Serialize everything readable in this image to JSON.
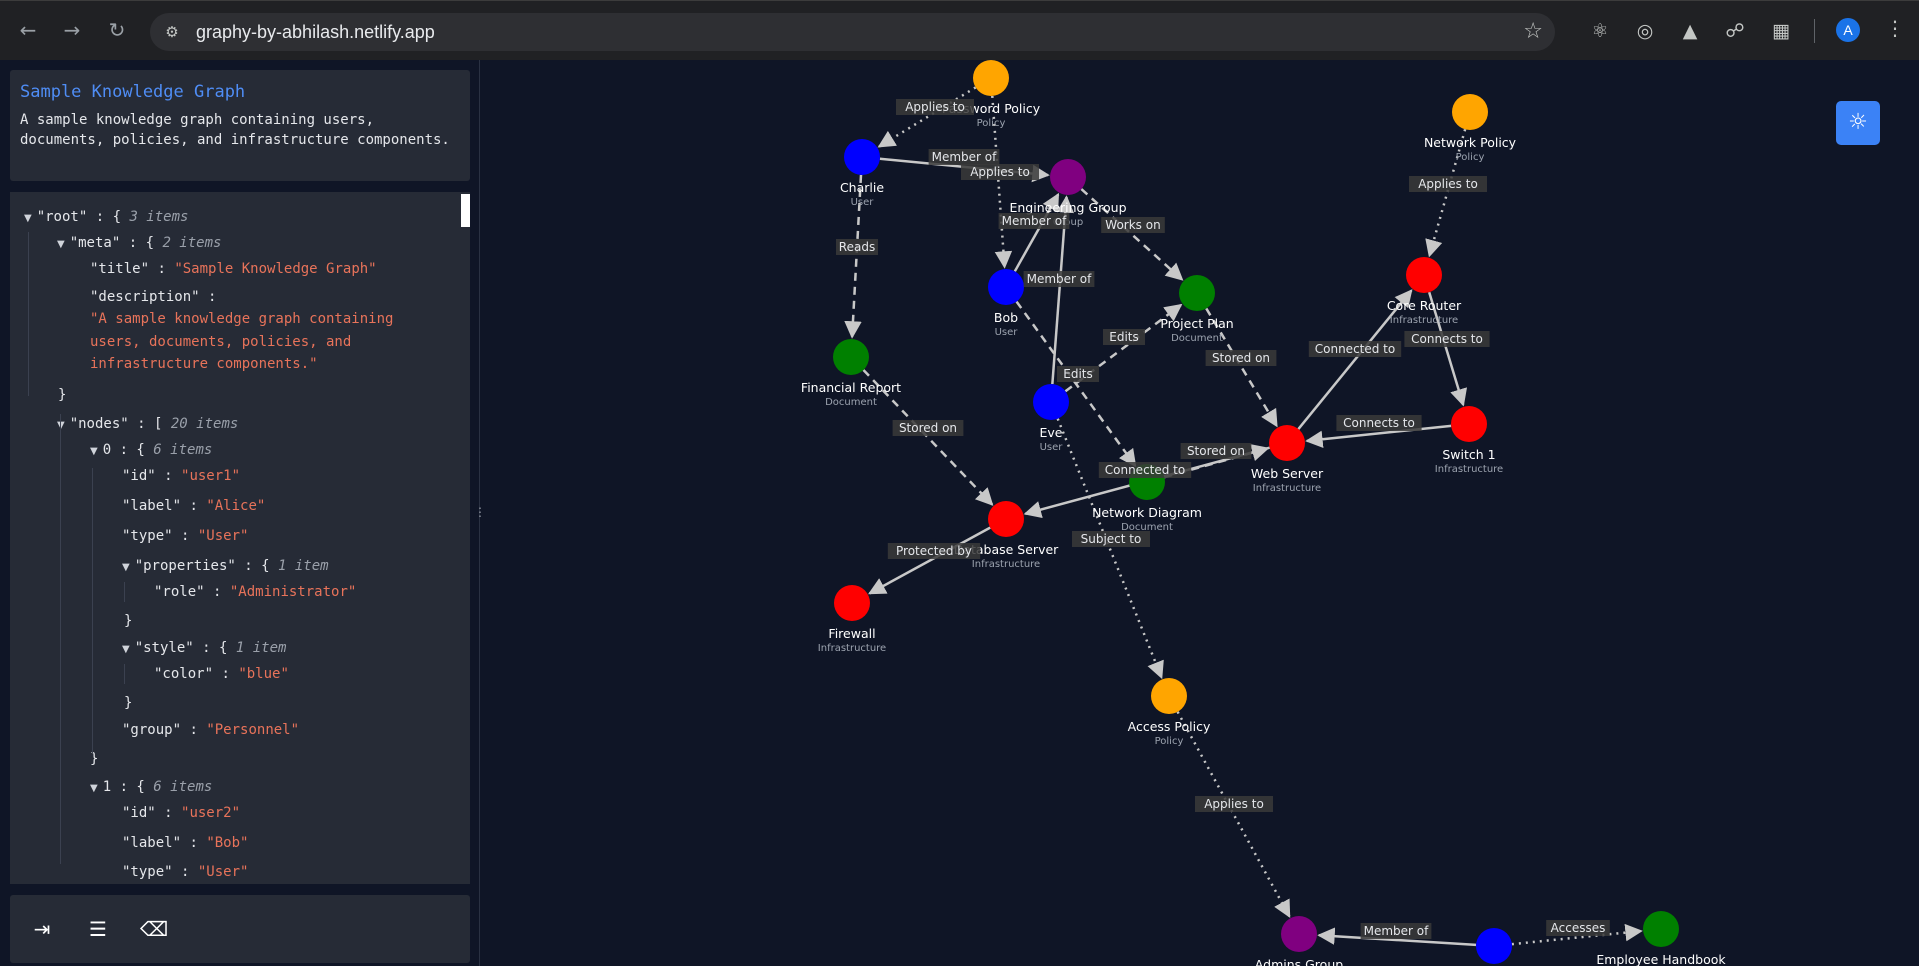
{
  "browser": {
    "url": "graphy-by-abhilash.netlify.app",
    "avatar_letter": "A",
    "icons": [
      "back-arrow-icon",
      "forward-arrow-icon",
      "reload-icon",
      "site-settings-icon",
      "star-icon",
      "react-devtools-icon",
      "target-extension-icon",
      "angular-extension-icon",
      "graph-extension-icon",
      "extensions-puzzle-icon",
      "more-menu-icon"
    ]
  },
  "info": {
    "title": "Sample Knowledge Graph",
    "description": "A sample knowledge graph containing users, documents, policies, and infrastructure components."
  },
  "json_tree": [
    {
      "text": "\"root\"",
      "suffix": " : { ",
      "count": "3 items",
      "toggle": true
    },
    {
      "text": "\"meta\"",
      "suffix": " : { ",
      "count": "2 items",
      "toggle": true
    },
    {
      "key": "\"title\"",
      "value": "\"Sample Knowledge Graph\""
    },
    {
      "key": "\"description\"",
      "sep": " :"
    },
    {
      "value": "\"A sample knowledge graph containing"
    },
    {
      "value": "users, documents, policies, and"
    },
    {
      "value": "infrastructure components.\""
    },
    {
      "brace": "}"
    },
    {
      "text": "\"nodes\"",
      "suffix": " : [ ",
      "count": "20 items",
      "toggle": true
    },
    {
      "text": "0",
      "suffix": " : { ",
      "count": "6 items",
      "toggle": true
    },
    {
      "key": "\"id\"",
      "value": "\"user1\""
    },
    {
      "key": "\"label\"",
      "value": "\"Alice\""
    },
    {
      "key": "\"type\"",
      "value": "\"User\""
    },
    {
      "text": "\"properties\"",
      "suffix": " : { ",
      "count": "1 item",
      "toggle": true
    },
    {
      "key": "\"role\"",
      "value": "\"Administrator\""
    },
    {
      "brace": "}"
    },
    {
      "text": "\"style\"",
      "suffix": " : { ",
      "count": "1 item",
      "toggle": true
    },
    {
      "key": "\"color\"",
      "value": "\"blue\""
    },
    {
      "brace": "}"
    },
    {
      "key": "\"group\"",
      "value": "\"Personnel\""
    },
    {
      "brace": "}"
    },
    {
      "text": "1",
      "suffix": " : { ",
      "count": "6 items",
      "toggle": true
    },
    {
      "key": "\"id\"",
      "value": "\"user2\""
    },
    {
      "key": "\"label\"",
      "value": "\"Bob\""
    },
    {
      "key": "\"type\"",
      "value": "\"User\""
    }
  ],
  "bottom_buttons": [
    {
      "name": "import-button",
      "icon": "file-import-icon",
      "color": "#3b82f6"
    },
    {
      "name": "database-button",
      "icon": "database-icon",
      "color": "#000000"
    },
    {
      "name": "clear-button",
      "icon": "eraser-icon",
      "color": "#b91c1c"
    }
  ],
  "graph": {
    "colors": {
      "User": "#0000ff",
      "Document": "#008000",
      "Policy": "#ffa500",
      "Group": "#800080",
      "Infrastructure": "#ff0000"
    },
    "nodes": [
      {
        "id": "pw",
        "label": "Password Policy",
        "type": "Policy"
      },
      {
        "id": "charlie",
        "label": "Charlie",
        "type": "User"
      },
      {
        "id": "eng",
        "label": "Engineering Group",
        "type": "Group"
      },
      {
        "id": "netpol",
        "label": "Network Policy",
        "type": "Policy"
      },
      {
        "id": "bob",
        "label": "Bob",
        "type": "User"
      },
      {
        "id": "projplan",
        "label": "Project Plan",
        "type": "Document"
      },
      {
        "id": "corerouter",
        "label": "Core Router",
        "type": "Infrastructure"
      },
      {
        "id": "finreport",
        "label": "Financial Report",
        "type": "Document"
      },
      {
        "id": "eve",
        "label": "Eve",
        "type": "User"
      },
      {
        "id": "webserver",
        "label": "Web Server",
        "type": "Infrastructure"
      },
      {
        "id": "switch1",
        "label": "Switch 1",
        "type": "Infrastructure"
      },
      {
        "id": "netdiag",
        "label": "Network Diagram",
        "type": "Document"
      },
      {
        "id": "dbserver",
        "label": "Database Server",
        "type": "Infrastructure"
      },
      {
        "id": "firewall",
        "label": "Firewall",
        "type": "Infrastructure"
      },
      {
        "id": "access",
        "label": "Access Policy",
        "type": "Policy"
      },
      {
        "id": "admins",
        "label": "Admins Group",
        "type": "Group"
      },
      {
        "id": "u_bottom",
        "label": "",
        "type": "User"
      },
      {
        "id": "handbook",
        "label": "Employee Handbook",
        "type": "Document"
      }
    ],
    "edges": [
      {
        "from": "pw",
        "to": "charlie",
        "label": "Applies to",
        "style": "dotted"
      },
      {
        "from": "charlie",
        "to": "eng",
        "label": "Member of",
        "style": "solid"
      },
      {
        "from": "pw",
        "to": "bob",
        "label": "Applies to",
        "style": "dotted"
      },
      {
        "from": "charlie",
        "to": "finreport",
        "label": "Reads",
        "style": "dashed"
      },
      {
        "from": "bob",
        "to": "eng",
        "label": "Member of",
        "style": "solid"
      },
      {
        "from": "eve",
        "to": "eng",
        "label": "Member of",
        "style": "solid"
      },
      {
        "from": "eng",
        "to": "projplan",
        "label": "Works on",
        "style": "dashed"
      },
      {
        "from": "netpol",
        "to": "corerouter",
        "label": "Applies to",
        "style": "dotted"
      },
      {
        "from": "eve",
        "to": "projplan",
        "label": "Edits",
        "style": "dashed"
      },
      {
        "from": "bob",
        "to": "netdiag",
        "label": "Edits",
        "style": "dashed"
      },
      {
        "from": "projplan",
        "to": "webserver",
        "label": "Stored on",
        "style": "dashed"
      },
      {
        "from": "webserver",
        "to": "corerouter",
        "label": "Connected to",
        "style": "solid"
      },
      {
        "from": "corerouter",
        "to": "switch1",
        "label": "Connects to",
        "style": "solid"
      },
      {
        "from": "switch1",
        "to": "webserver",
        "label": "Connects to",
        "style": "solid"
      },
      {
        "from": "finreport",
        "to": "dbserver",
        "label": "Stored on",
        "style": "dashed"
      },
      {
        "from": "netdiag",
        "to": "webserver",
        "label": "Stored on",
        "style": "dashed"
      },
      {
        "from": "webserver",
        "to": "dbserver",
        "label": "Connected to",
        "style": "solid"
      },
      {
        "from": "dbserver",
        "to": "firewall",
        "label": "Protected by",
        "style": "solid"
      },
      {
        "from": "eve",
        "to": "access",
        "label": "Subject to",
        "style": "dotted"
      },
      {
        "from": "access",
        "to": "admins",
        "label": "Applies to",
        "style": "dotted"
      },
      {
        "from": "u_bottom",
        "to": "admins",
        "label": "Member of",
        "style": "solid"
      },
      {
        "from": "u_bottom",
        "to": "handbook",
        "label": "Accesses",
        "style": "dotted"
      }
    ]
  }
}
